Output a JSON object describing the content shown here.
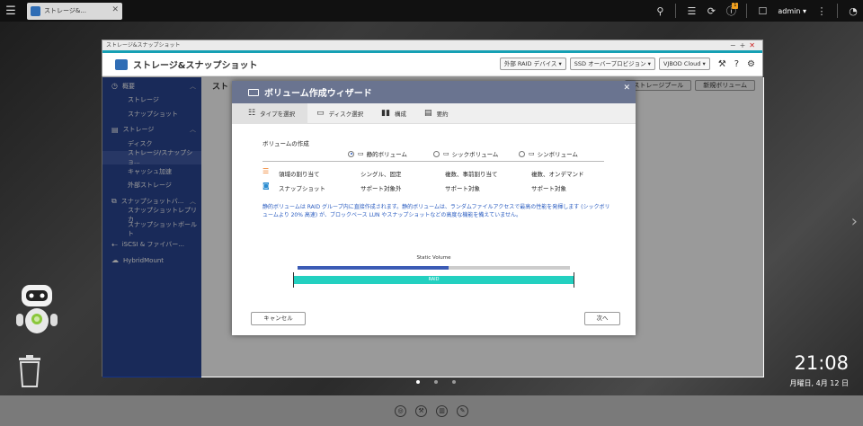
{
  "topbar": {
    "tab_label": "ストレージ&...",
    "admin": "admin ▾",
    "badge": "1"
  },
  "window": {
    "title": "ストレージ&スナップショット",
    "app_title": "ストレージ&スナップショット",
    "header_buttons": [
      "外部 RAID デバイス ▾",
      "SSD オーバープロビジョン ▾",
      "VJBOD Cloud ▾"
    ]
  },
  "sidebar": {
    "items": [
      {
        "label": "概要",
        "type": "sec",
        "icon": "◷",
        "caret": "︿"
      },
      {
        "label": "ストレージ",
        "type": "sub"
      },
      {
        "label": "スナップショット",
        "type": "sub"
      },
      {
        "label": "ストレージ",
        "type": "sec",
        "icon": "▤",
        "caret": "︿"
      },
      {
        "label": "ディスク",
        "type": "sub"
      },
      {
        "label": "ストレージ/スナップショ...",
        "type": "sub",
        "active": true
      },
      {
        "label": "キャッシュ加速",
        "type": "sub"
      },
      {
        "label": "外部ストレージ",
        "type": "sub"
      },
      {
        "label": "スナップショットバ...",
        "type": "sec",
        "icon": "⧉",
        "caret": "︿"
      },
      {
        "label": "スナップショットレプリカ",
        "type": "sub"
      },
      {
        "label": "スナップショットボールト",
        "type": "sub"
      },
      {
        "label": "iSCSI & ファイバー...",
        "type": "sec",
        "icon": "⇠"
      },
      {
        "label": "HybridMount",
        "type": "sec",
        "icon": "☁"
      }
    ]
  },
  "content": {
    "title": "スト",
    "buttons": [
      "ストレージプール",
      "新規ボリューム"
    ]
  },
  "dialog": {
    "title": "ボリューム作成ウィザード",
    "steps": [
      "タイプを選択",
      "ディスク選択",
      "構成",
      "要約"
    ],
    "section_label": "ボリュームの作成",
    "options": [
      "静的ボリューム",
      "シックボリューム",
      "シンボリューム"
    ],
    "rows": [
      {
        "label": "領域の割り当て",
        "values": [
          "シングル、固定",
          "複数、事前割り当て",
          "複数、オンデマンド"
        ]
      },
      {
        "label": "スナップショット",
        "values": [
          "サポート対象外",
          "サポート対象",
          "サポート対象"
        ]
      }
    ],
    "description": "静的ボリュームは RAID グループ内に直接作成されます。静的ボリュームは、ランダムファイルアクセスで最高の性能を発揮します (シックボリュームより 20% 高速) が、ブロックベース LUN やスナップショットなどの高度な機能を備えていません。",
    "volume_label": "Static Volume",
    "raid_label": "RAID",
    "cancel": "キャンセル",
    "next": "次へ"
  },
  "desktop": {
    "time": "21:08",
    "date": "月曜日, 4月 12 日"
  }
}
